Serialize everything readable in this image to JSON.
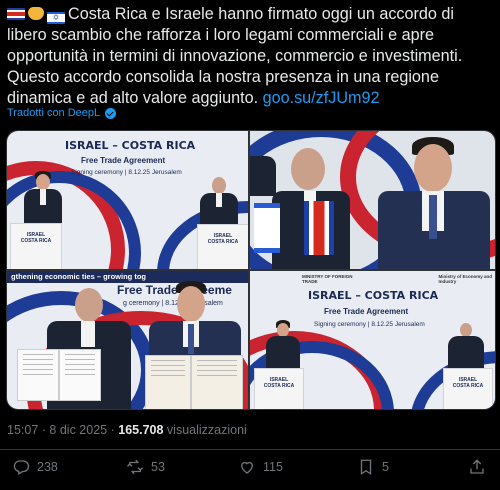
{
  "post": {
    "body_text": "Costa Rica e Israele hanno firmato oggi un accordo di libero scambio che rafforza i loro legami commerciali e apre opportunità in termini di innovazione, commercio e investimenti. Questo accordo consolida la nostra presenza in una regione dinamica e ad alto valore aggiunto.",
    "link_text": "goo.su/zfJUm92",
    "translated_label": "Tradotti con DeepL"
  },
  "photos": {
    "banner_title": "ISRAEL – COSTA RICA",
    "banner_subtitle": "Free Trade Agreement",
    "banner_ceremony": "Signing ceremony | 8.12.25 Jerusalem",
    "banner_strip": "gthening economic ties – growing tog",
    "banner_partial": "Free Trade Agreeme",
    "banner_partial_small": "g ceremony | 8.12.25 Jerusalem",
    "podium_label_1": "ISRAEL",
    "podium_label_2": "COSTA RICA",
    "logo_text_1": "MINISTRY OF FOREIGN TRADE",
    "logo_text_2": "Ministry of Economy and Industry"
  },
  "meta": {
    "time": "15:07",
    "separator": "·",
    "date": "8 dic 2025",
    "views_count": "165.708",
    "views_label": "visualizzazioni"
  },
  "actions": {
    "replies": "238",
    "reposts": "53",
    "likes": "115",
    "bookmarks": "5"
  },
  "colors": {
    "background": "#000000",
    "text": "#e7e9ea",
    "secondary_text": "#71767b",
    "link": "#1d9bf0"
  }
}
